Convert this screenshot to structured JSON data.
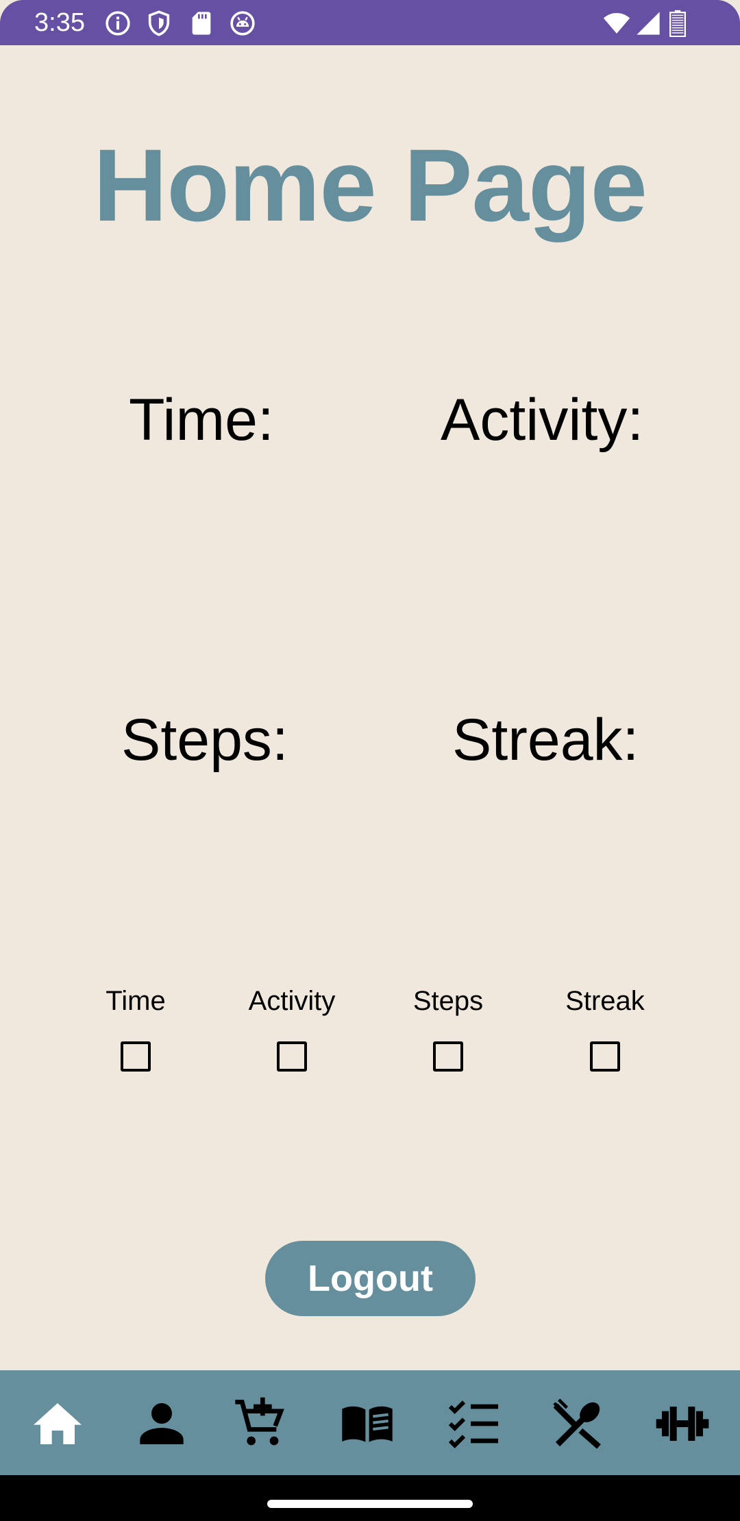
{
  "status_bar": {
    "time": "3:35",
    "background": "#6650A4",
    "left_icons": [
      "info-icon",
      "shield-icon",
      "sd-card-icon",
      "android-debug-icon"
    ],
    "right_icons": [
      "wifi-icon",
      "cell-signal-icon",
      "battery-icon"
    ]
  },
  "page": {
    "title": "Home Page",
    "title_color": "#658F9D",
    "background": "#F0E8DD"
  },
  "stats": {
    "time_label": "Time:",
    "activity_label": "Activity:",
    "steps_label": "Steps:",
    "streak_label": "Streak:"
  },
  "checkboxes": [
    {
      "label": "Time",
      "checked": false
    },
    {
      "label": "Activity",
      "checked": false
    },
    {
      "label": "Steps",
      "checked": false
    },
    {
      "label": "Streak",
      "checked": false
    }
  ],
  "logout": {
    "label": "Logout",
    "color": "#658F9D"
  },
  "bottom_nav": {
    "background": "#658F9D",
    "items": [
      {
        "icon": "home-icon",
        "selected": true
      },
      {
        "icon": "person-icon",
        "selected": false
      },
      {
        "icon": "add-shopping-cart-icon",
        "selected": false
      },
      {
        "icon": "menu-book-icon",
        "selected": false
      },
      {
        "icon": "checklist-icon",
        "selected": false
      },
      {
        "icon": "restaurant-icon",
        "selected": false
      },
      {
        "icon": "fitness-center-icon",
        "selected": false
      }
    ]
  }
}
